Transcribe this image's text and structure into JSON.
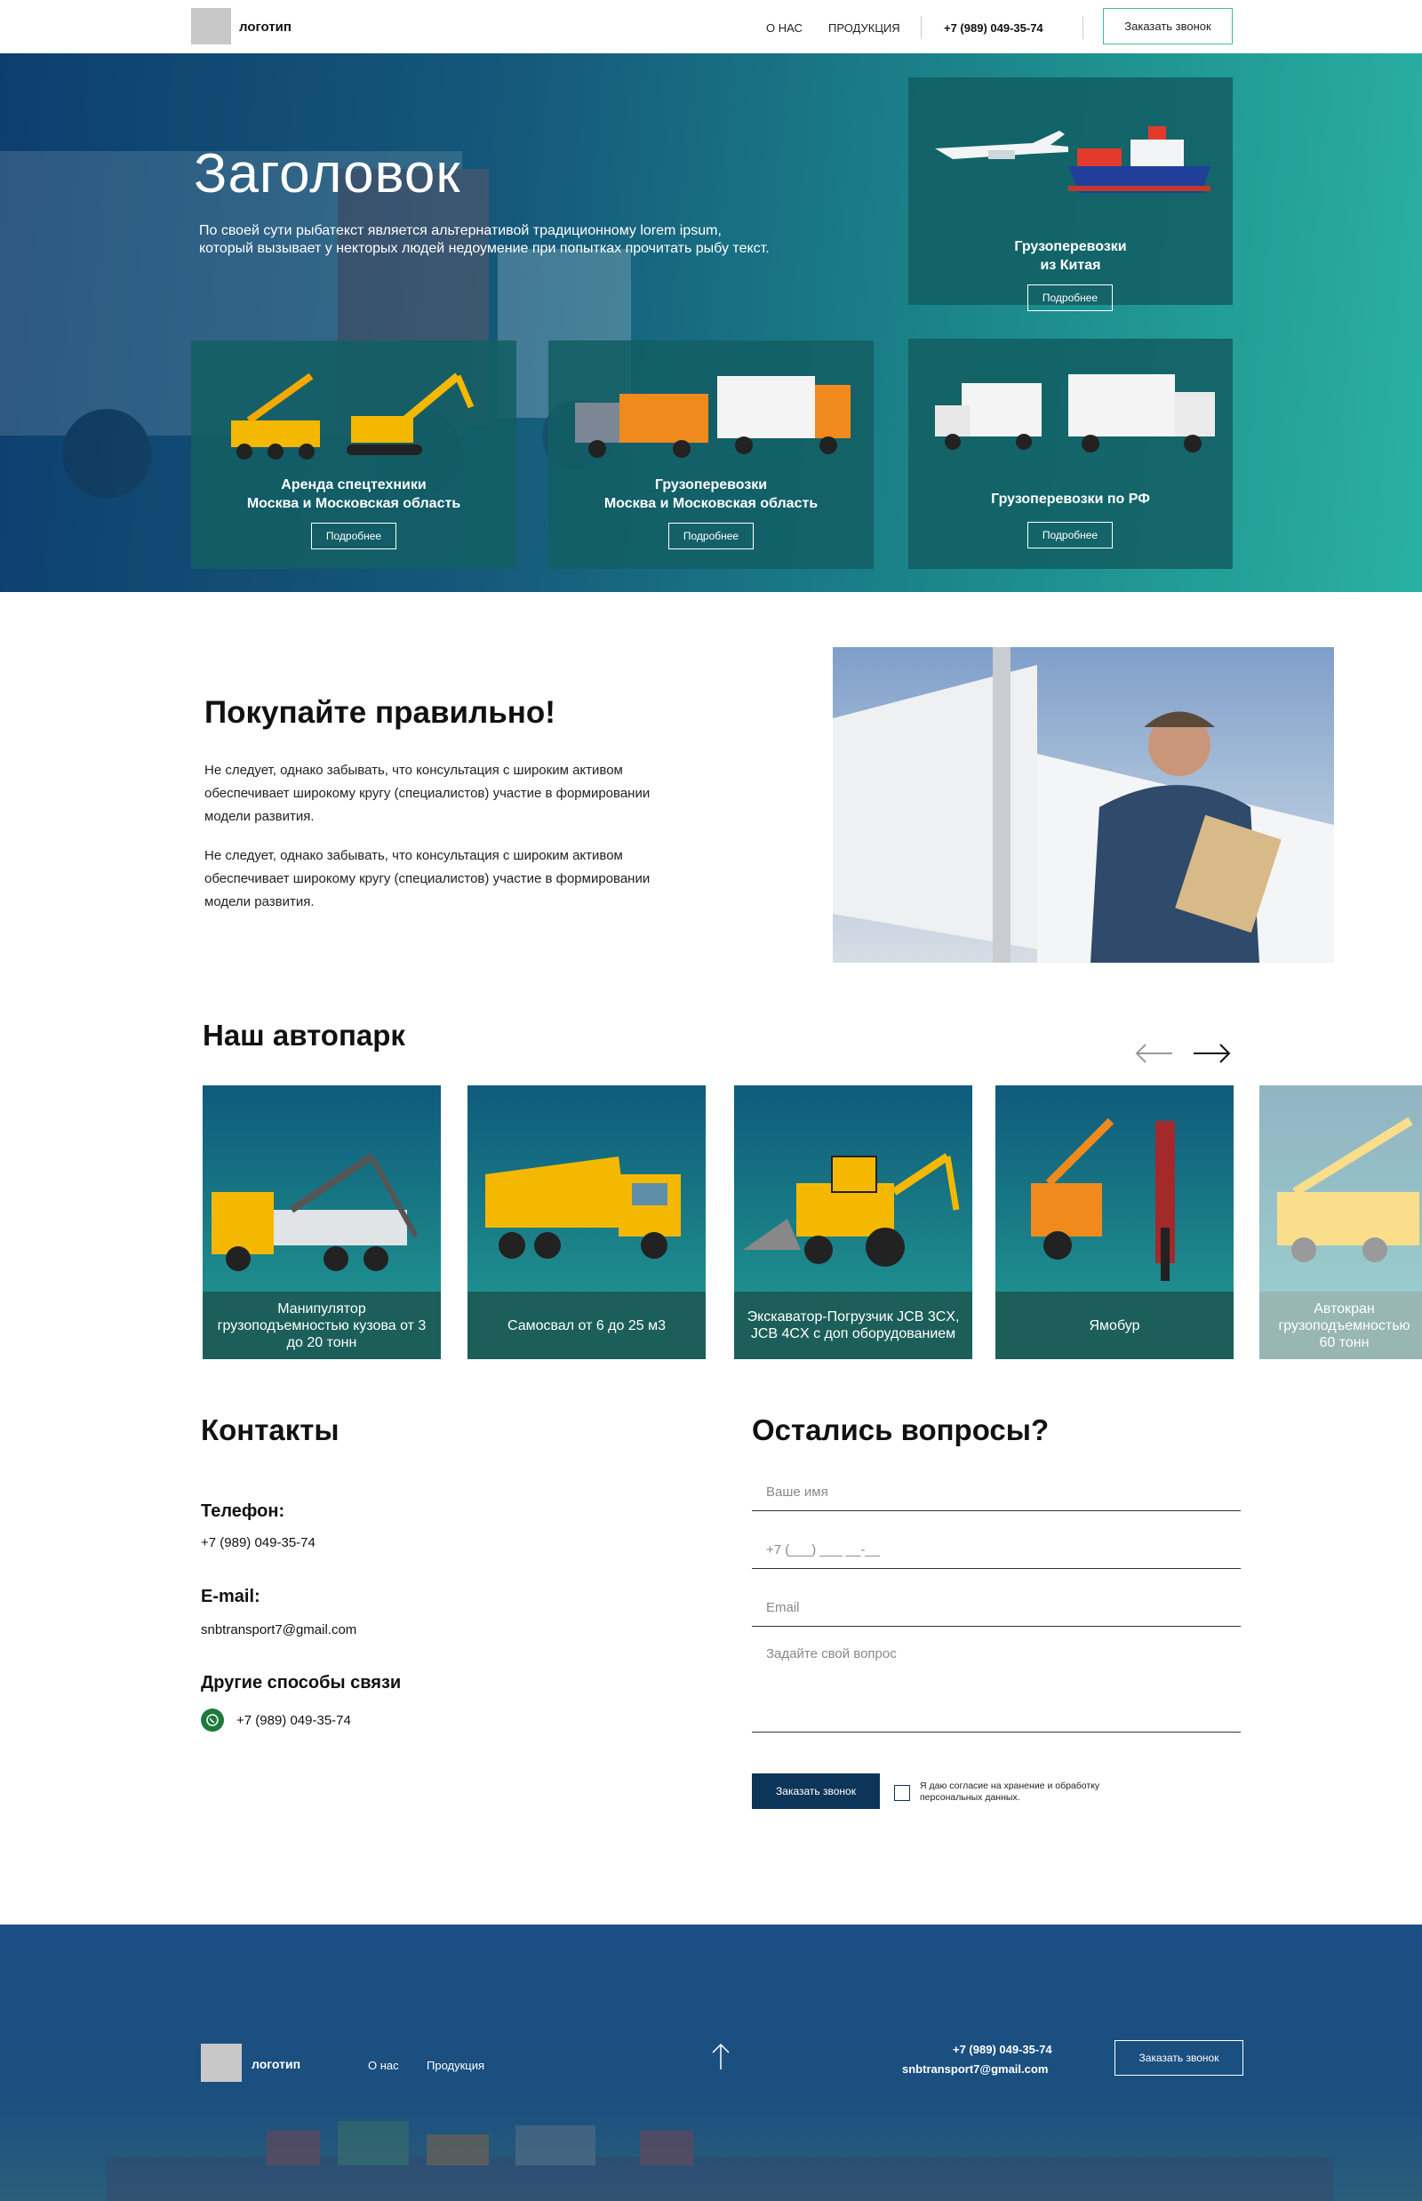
{
  "header": {
    "logo_text": "логотип",
    "nav": [
      "О НАС",
      "ПРОДУКЦИЯ"
    ],
    "phone": "+7 (989) 049-35-74",
    "cta_label": "Заказать звонок"
  },
  "hero": {
    "title": "Заголовок",
    "text": "По своей сути рыбатекст является альтернативой традиционному lorem ipsum, который вызывает у некторых людей недоумение при попытках прочитать рыбу текст.",
    "cards": [
      {
        "title_line1": "Грузоперевозки",
        "title_line2": "из Китая",
        "button": "Подробнее"
      },
      {
        "title_line1": "Аренда спецтехники",
        "title_line2": "Москва и Московская область",
        "button": "Подробнее"
      },
      {
        "title_line1": "Грузоперевозки",
        "title_line2": "Москва и Московская область",
        "button": "Подробнее"
      },
      {
        "title_line1": "Грузоперевозки по РФ",
        "title_line2": "",
        "button": "Подробнее"
      }
    ]
  },
  "buy": {
    "title": "Покупайте правильно!",
    "paragraphs": [
      "Не следует, однако забывать, что консультация с широким активом обеспечивает широкому кругу (специалистов) участие в формировании модели развития.",
      "Не следует, однако забывать, что консультация с широким активом обеспечивает широкому кругу (специалистов) участие в формировании модели развития."
    ]
  },
  "fleet": {
    "title": "Наш автопарк",
    "items": [
      "Манипулятор грузоподъемностью кузова от 3 до 20 тонн",
      "Самосвал от 6 до 25 м3",
      "Экскаватор-Погрузчик JCB 3CX, JCB 4CX с доп оборудованием",
      "Ямобур",
      "Автокран грузоподъемностью 60 тонн"
    ],
    "colors": {
      "yellow": "#f5b800",
      "orange": "#f08a1c",
      "cap": "#1c5f5a"
    }
  },
  "contacts": {
    "title": "Контакты",
    "phone_label": "Телефон:",
    "phone": "+7 (989) 049-35-74",
    "email_label": "E-mail:",
    "email": "snbtransport7@gmail.com",
    "other_label": "Другие способы связи",
    "whatsapp": "+7 (989) 049-35-74"
  },
  "form": {
    "title": "Остались вопросы?",
    "name_placeholder": "Ваше имя",
    "phone_placeholder": "+7 (___) ___ __-__",
    "email_placeholder": "Email",
    "question_placeholder": "Задайте свой вопрос",
    "submit_label": "Заказать звонок",
    "consent_text": "Я даю согласие на хранение и обработку персональных данных."
  },
  "footer": {
    "logo_text": "логотип",
    "nav": [
      "О нас",
      "Продукция"
    ],
    "phone": "+7 (989) 049-35-74",
    "email": "snbtransport7@gmail.com",
    "cta_label": "Заказать звонок"
  }
}
